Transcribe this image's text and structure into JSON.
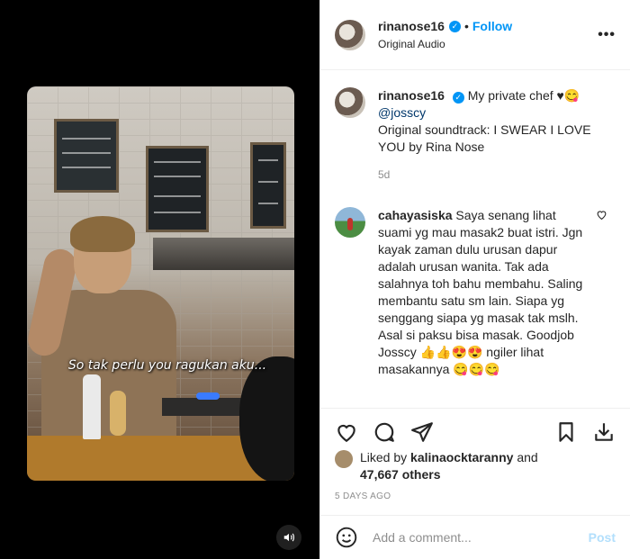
{
  "post": {
    "author": "rinanose16",
    "audio": "Original Audio",
    "follow_label": "Follow",
    "separator": "•",
    "more_label": "•••",
    "verified_glyph": "✓"
  },
  "video": {
    "subtitle": "So tak perlu you ragukan aku...",
    "sound_icon": "speaker-icon"
  },
  "caption": {
    "author": "rinanose16",
    "text": "My private chef ♥😋",
    "mention": "@josscy",
    "soundtrack": "Original soundtrack: I SWEAR I LOVE YOU by Rina Nose",
    "time": "5d"
  },
  "comment": {
    "author": "cahayasiska",
    "text": "Saya senang lihat suami yg mau masak2 buat istri. Jgn kayak zaman dulu urusan dapur adalah urusan wanita. Tak ada salahnya toh bahu membahu. Saling membantu satu sm lain. Siapa yg senggang siapa yg masak tak mslh. Asal si paksu bisa masak. Goodjob Josscy 👍👍😍😍 ngiler lihat masakannya 😋😋😋",
    "like_icon": "heart-icon"
  },
  "actions": {
    "like_icon": "heart-icon",
    "comment_icon": "comment-bubble-icon",
    "share_icon": "paper-plane-icon",
    "save_icon": "bookmark-icon",
    "download_icon": "download-icon"
  },
  "likes": {
    "prefix": "Liked by",
    "user": "kalinaocktaranny",
    "and": "and",
    "others": "47,667 others"
  },
  "date": "5 DAYS AGO",
  "add_comment": {
    "placeholder": "Add a comment...",
    "post_label": "Post",
    "emoji_icon": "smiley-icon"
  },
  "colors": {
    "accent": "#0095f6",
    "mention": "#00376b",
    "muted": "#8e8e8e",
    "post_disabled": "#b2dffc"
  }
}
